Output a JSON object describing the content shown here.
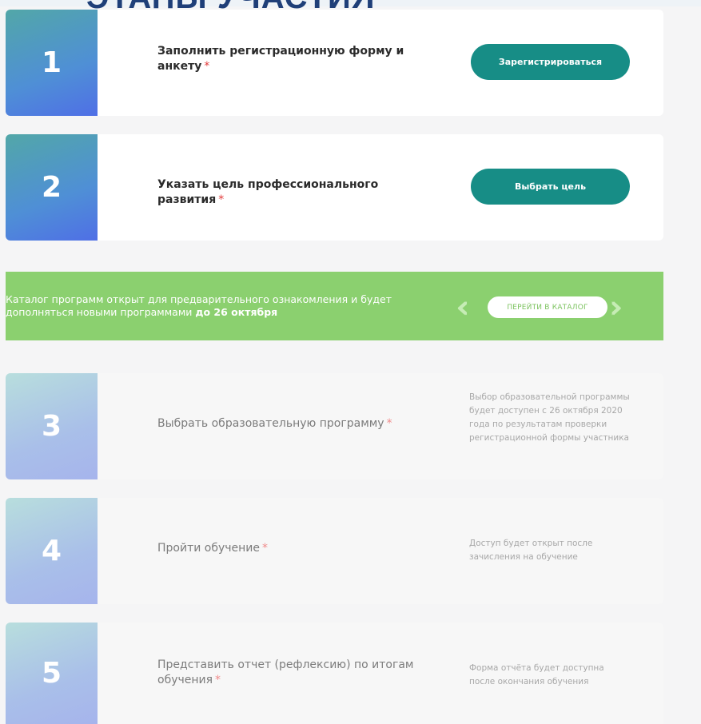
{
  "header": {
    "title_partial": "ЭТАПЫ УЧАСТИЯ"
  },
  "steps_active": [
    {
      "number": "1",
      "text": "Заполнить регистрационную форму и анкету",
      "required_mark": "*",
      "button": "Зарегистрироваться"
    },
    {
      "number": "2",
      "text": "Указать цель профессионального развития",
      "required_mark": "*",
      "button": "Выбрать цель"
    }
  ],
  "banner": {
    "text_main": "Каталог программ открыт для предварительного ознакомления и будет дополняться новыми программами",
    "text_bold": "до 26 октября",
    "button": "ПЕРЕЙТИ В КАТАЛОГ"
  },
  "steps_locked": [
    {
      "number": "3",
      "text": "Выбрать образовательную программу",
      "required_mark": "*",
      "note": "Выбор образовательной программы будет доступен с 26 октября 2020 года по результатам проверки регистрационной формы участника"
    },
    {
      "number": "4",
      "text": "Пройти обучение",
      "required_mark": "*",
      "note": "Доступ будет открыт после зачисления на обучение"
    },
    {
      "number": "5",
      "text": "Представить отчет (рефлексию) по итогам обучения",
      "required_mark": "*",
      "note": "Форма отчёта будет доступна после окончания обучения"
    }
  ],
  "colors": {
    "accent_button": "#178d86",
    "banner_green": "#8bd06f",
    "required_red": "#e23b3b",
    "title_blue": "#1f3f78"
  }
}
